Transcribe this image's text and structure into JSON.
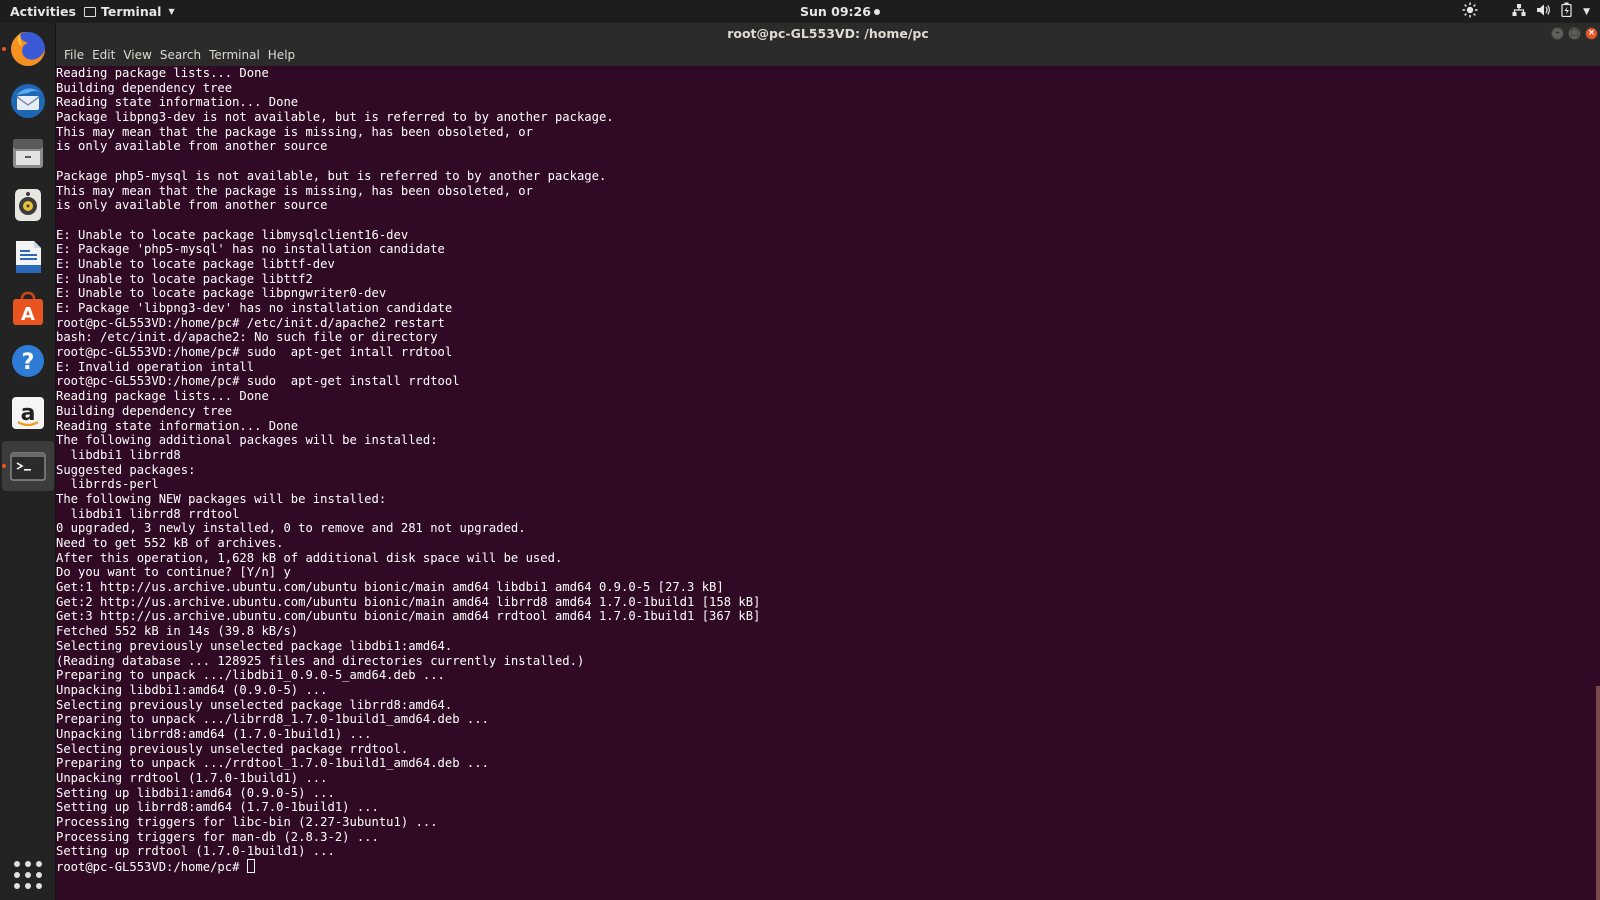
{
  "topbar": {
    "activities": "Activities",
    "app_name": "Terminal",
    "clock": "Sun 09:26"
  },
  "window": {
    "title": "root@pc-GL553VD: /home/pc"
  },
  "menubar": {
    "items": [
      "File",
      "Edit",
      "View",
      "Search",
      "Terminal",
      "Help"
    ]
  },
  "dock": {
    "items": [
      "firefox-icon",
      "thunderbird-icon",
      "files-icon",
      "rhythmbox-icon",
      "libreoffice-writer-icon",
      "software-center-icon",
      "help-icon",
      "amazon-icon",
      "terminal-icon"
    ]
  },
  "terminal": {
    "lines": [
      "Reading package lists... Done",
      "Building dependency tree",
      "Reading state information... Done",
      "Package libpng3-dev is not available, but is referred to by another package.",
      "This may mean that the package is missing, has been obsoleted, or",
      "is only available from another source",
      "",
      "Package php5-mysql is not available, but is referred to by another package.",
      "This may mean that the package is missing, has been obsoleted, or",
      "is only available from another source",
      "",
      "E: Unable to locate package libmysqlclient16-dev",
      "E: Package 'php5-mysql' has no installation candidate",
      "E: Unable to locate package libttf-dev",
      "E: Unable to locate package libttf2",
      "E: Unable to locate package libpngwriter0-dev",
      "E: Package 'libpng3-dev' has no installation candidate",
      "root@pc-GL553VD:/home/pc# /etc/init.d/apache2 restart",
      "bash: /etc/init.d/apache2: No such file or directory",
      "root@pc-GL553VD:/home/pc# sudo  apt-get intall rrdtool",
      "E: Invalid operation intall",
      "root@pc-GL553VD:/home/pc# sudo  apt-get install rrdtool",
      "Reading package lists... Done",
      "Building dependency tree",
      "Reading state information... Done",
      "The following additional packages will be installed:",
      "  libdbi1 librrd8",
      "Suggested packages:",
      "  librrds-perl",
      "The following NEW packages will be installed:",
      "  libdbi1 librrd8 rrdtool",
      "0 upgraded, 3 newly installed, 0 to remove and 281 not upgraded.",
      "Need to get 552 kB of archives.",
      "After this operation, 1,628 kB of additional disk space will be used.",
      "Do you want to continue? [Y/n] y",
      "Get:1 http://us.archive.ubuntu.com/ubuntu bionic/main amd64 libdbi1 amd64 0.9.0-5 [27.3 kB]",
      "Get:2 http://us.archive.ubuntu.com/ubuntu bionic/main amd64 librrd8 amd64 1.7.0-1build1 [158 kB]",
      "Get:3 http://us.archive.ubuntu.com/ubuntu bionic/main amd64 rrdtool amd64 1.7.0-1build1 [367 kB]",
      "Fetched 552 kB in 14s (39.8 kB/s)",
      "Selecting previously unselected package libdbi1:amd64.",
      "(Reading database ... 128925 files and directories currently installed.)",
      "Preparing to unpack .../libdbi1_0.9.0-5_amd64.deb ...",
      "Unpacking libdbi1:amd64 (0.9.0-5) ...",
      "Selecting previously unselected package librrd8:amd64.",
      "Preparing to unpack .../librrd8_1.7.0-1build1_amd64.deb ...",
      "Unpacking librrd8:amd64 (1.7.0-1build1) ...",
      "Selecting previously unselected package rrdtool.",
      "Preparing to unpack .../rrdtool_1.7.0-1build1_amd64.deb ...",
      "Unpacking rrdtool (1.7.0-1build1) ...",
      "Setting up libdbi1:amd64 (0.9.0-5) ...",
      "Setting up librrd8:amd64 (1.7.0-1build1) ...",
      "Processing triggers for libc-bin (2.27-3ubuntu1) ...",
      "Processing triggers for man-db (2.8.3-2) ...",
      "Setting up rrdtool (1.7.0-1build1) ..."
    ],
    "prompt": "root@pc-GL553VD:/home/pc# "
  },
  "colors": {
    "terminal_bg": "#300a24",
    "accent": "#e95420"
  }
}
